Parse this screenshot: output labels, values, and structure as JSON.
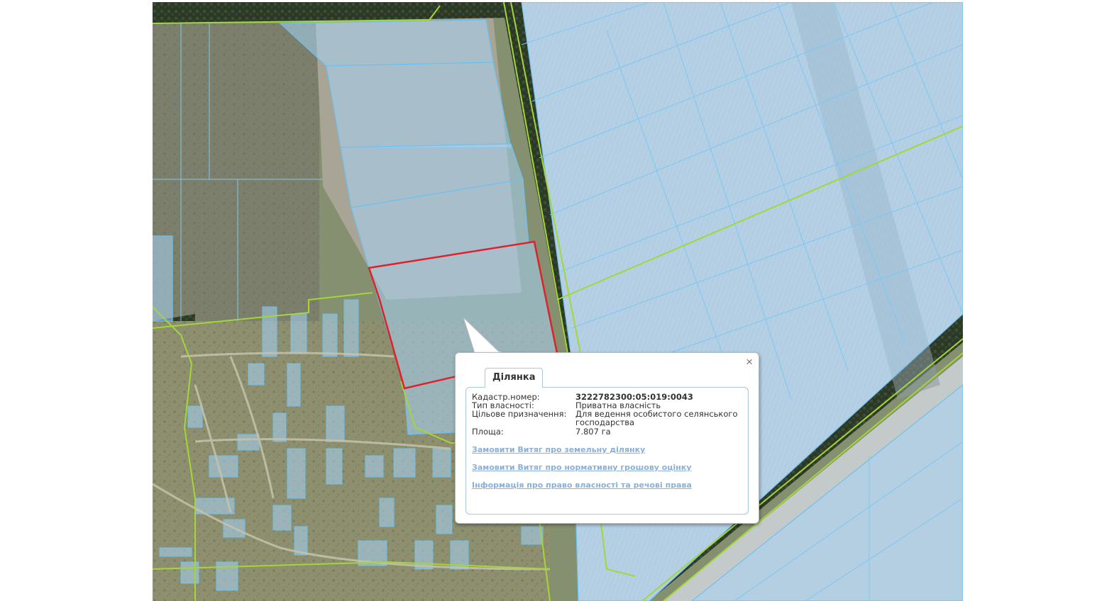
{
  "map": {
    "colors": {
      "parcel_fill": "#a7d3f5",
      "parcel_stroke": "#6cc0f0",
      "boundary_green": "#a4d63a",
      "selected_red": "#e0202a",
      "forest": "#2e3b28",
      "field_gray": "#9c9a8e"
    }
  },
  "popup": {
    "tab_label": "Ділянка",
    "close_glyph": "×",
    "rows": [
      {
        "label": "Кадастр.номер:",
        "value": "3222782300:05:019:0043"
      },
      {
        "label": "Тип власності:",
        "value": "Приватна власність"
      },
      {
        "label": "Цільове призначення:",
        "value": "Для ведення особистого селянського господарства"
      },
      {
        "label": "Площа:",
        "value": "7.807 га"
      }
    ],
    "links": [
      "Замовити Витяг про земельну ділянку",
      "Замовити Витяг про нормативну грошову оцінку",
      "Інформація про право власності та речові права"
    ]
  }
}
